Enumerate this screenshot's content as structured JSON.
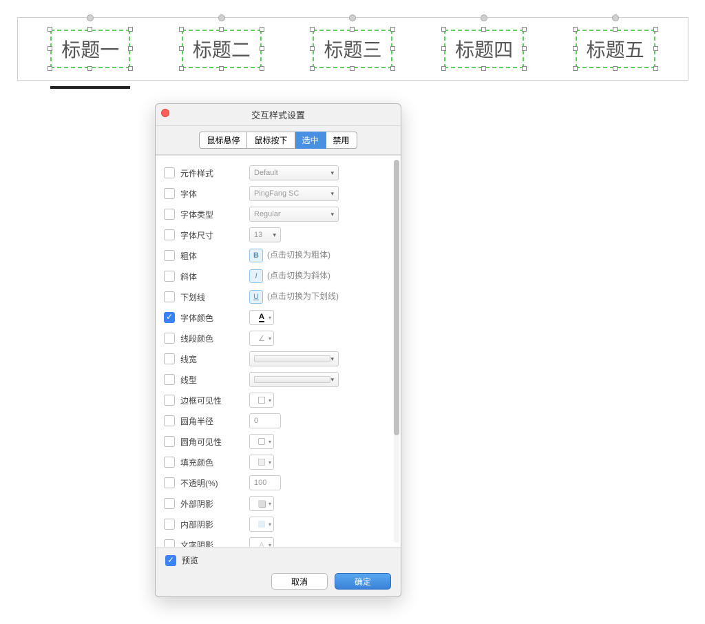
{
  "canvas": {
    "tabs": [
      "标题一",
      "标题二",
      "标题三",
      "标题四",
      "标题五"
    ]
  },
  "dialog": {
    "title": "交互样式设置",
    "segTabs": {
      "hover": "鼠标悬停",
      "press": "鼠标按下",
      "selected": "选中",
      "disabled": "禁用"
    },
    "props": {
      "widgetStyle": {
        "label": "元件样式",
        "value": "Default"
      },
      "font": {
        "label": "字体",
        "value": "PingFang SC"
      },
      "fontType": {
        "label": "字体类型",
        "value": "Regular"
      },
      "fontSize": {
        "label": "字体尺寸",
        "value": "13"
      },
      "bold": {
        "label": "粗体",
        "glyph": "B",
        "hint": "(点击切换为粗体)"
      },
      "italic": {
        "label": "斜体",
        "glyph": "I",
        "hint": "(点击切换为斜体)"
      },
      "underline": {
        "label": "下划线",
        "glyph": "U",
        "hint": "(点击切换为下划线)"
      },
      "fontColor": {
        "label": "字体颜色",
        "glyph": "A"
      },
      "lineColor": {
        "label": "线段颜色",
        "glyph": "∠"
      },
      "lineWidth": {
        "label": "线宽"
      },
      "lineType": {
        "label": "线型"
      },
      "borderVis": {
        "label": "边框可见性"
      },
      "cornerRadius": {
        "label": "圆角半径",
        "value": "0"
      },
      "cornerVis": {
        "label": "圆角可见性"
      },
      "fillColor": {
        "label": "填充颜色"
      },
      "opacity": {
        "label": "不透明(%)",
        "value": "100"
      },
      "outerShadow": {
        "label": "外部阴影"
      },
      "innerShadow": {
        "label": "内部阴影"
      },
      "textShadow": {
        "label": "文字阴影"
      }
    },
    "preview": "预览",
    "cancel": "取消",
    "confirm": "确定"
  }
}
